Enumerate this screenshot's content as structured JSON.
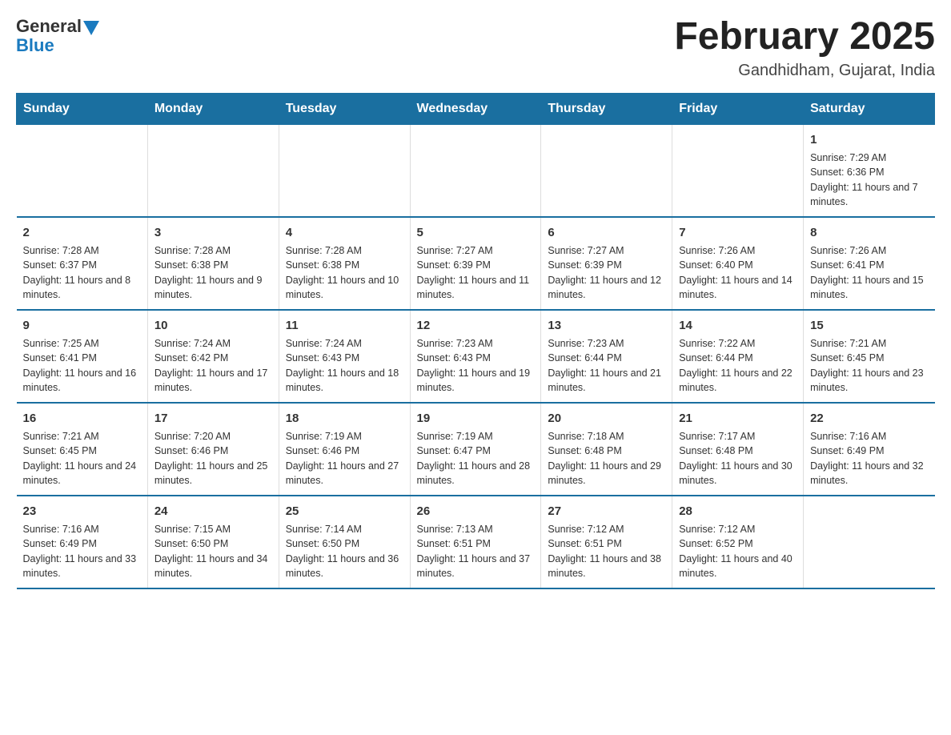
{
  "logo": {
    "general": "General",
    "blue": "Blue"
  },
  "title": "February 2025",
  "subtitle": "Gandhidham, Gujarat, India",
  "weekdays": [
    "Sunday",
    "Monday",
    "Tuesday",
    "Wednesday",
    "Thursday",
    "Friday",
    "Saturday"
  ],
  "weeks": [
    [
      {
        "day": "",
        "info": ""
      },
      {
        "day": "",
        "info": ""
      },
      {
        "day": "",
        "info": ""
      },
      {
        "day": "",
        "info": ""
      },
      {
        "day": "",
        "info": ""
      },
      {
        "day": "",
        "info": ""
      },
      {
        "day": "1",
        "info": "Sunrise: 7:29 AM\nSunset: 6:36 PM\nDaylight: 11 hours and 7 minutes."
      }
    ],
    [
      {
        "day": "2",
        "info": "Sunrise: 7:28 AM\nSunset: 6:37 PM\nDaylight: 11 hours and 8 minutes."
      },
      {
        "day": "3",
        "info": "Sunrise: 7:28 AM\nSunset: 6:38 PM\nDaylight: 11 hours and 9 minutes."
      },
      {
        "day": "4",
        "info": "Sunrise: 7:28 AM\nSunset: 6:38 PM\nDaylight: 11 hours and 10 minutes."
      },
      {
        "day": "5",
        "info": "Sunrise: 7:27 AM\nSunset: 6:39 PM\nDaylight: 11 hours and 11 minutes."
      },
      {
        "day": "6",
        "info": "Sunrise: 7:27 AM\nSunset: 6:39 PM\nDaylight: 11 hours and 12 minutes."
      },
      {
        "day": "7",
        "info": "Sunrise: 7:26 AM\nSunset: 6:40 PM\nDaylight: 11 hours and 14 minutes."
      },
      {
        "day": "8",
        "info": "Sunrise: 7:26 AM\nSunset: 6:41 PM\nDaylight: 11 hours and 15 minutes."
      }
    ],
    [
      {
        "day": "9",
        "info": "Sunrise: 7:25 AM\nSunset: 6:41 PM\nDaylight: 11 hours and 16 minutes."
      },
      {
        "day": "10",
        "info": "Sunrise: 7:24 AM\nSunset: 6:42 PM\nDaylight: 11 hours and 17 minutes."
      },
      {
        "day": "11",
        "info": "Sunrise: 7:24 AM\nSunset: 6:43 PM\nDaylight: 11 hours and 18 minutes."
      },
      {
        "day": "12",
        "info": "Sunrise: 7:23 AM\nSunset: 6:43 PM\nDaylight: 11 hours and 19 minutes."
      },
      {
        "day": "13",
        "info": "Sunrise: 7:23 AM\nSunset: 6:44 PM\nDaylight: 11 hours and 21 minutes."
      },
      {
        "day": "14",
        "info": "Sunrise: 7:22 AM\nSunset: 6:44 PM\nDaylight: 11 hours and 22 minutes."
      },
      {
        "day": "15",
        "info": "Sunrise: 7:21 AM\nSunset: 6:45 PM\nDaylight: 11 hours and 23 minutes."
      }
    ],
    [
      {
        "day": "16",
        "info": "Sunrise: 7:21 AM\nSunset: 6:45 PM\nDaylight: 11 hours and 24 minutes."
      },
      {
        "day": "17",
        "info": "Sunrise: 7:20 AM\nSunset: 6:46 PM\nDaylight: 11 hours and 25 minutes."
      },
      {
        "day": "18",
        "info": "Sunrise: 7:19 AM\nSunset: 6:46 PM\nDaylight: 11 hours and 27 minutes."
      },
      {
        "day": "19",
        "info": "Sunrise: 7:19 AM\nSunset: 6:47 PM\nDaylight: 11 hours and 28 minutes."
      },
      {
        "day": "20",
        "info": "Sunrise: 7:18 AM\nSunset: 6:48 PM\nDaylight: 11 hours and 29 minutes."
      },
      {
        "day": "21",
        "info": "Sunrise: 7:17 AM\nSunset: 6:48 PM\nDaylight: 11 hours and 30 minutes."
      },
      {
        "day": "22",
        "info": "Sunrise: 7:16 AM\nSunset: 6:49 PM\nDaylight: 11 hours and 32 minutes."
      }
    ],
    [
      {
        "day": "23",
        "info": "Sunrise: 7:16 AM\nSunset: 6:49 PM\nDaylight: 11 hours and 33 minutes."
      },
      {
        "day": "24",
        "info": "Sunrise: 7:15 AM\nSunset: 6:50 PM\nDaylight: 11 hours and 34 minutes."
      },
      {
        "day": "25",
        "info": "Sunrise: 7:14 AM\nSunset: 6:50 PM\nDaylight: 11 hours and 36 minutes."
      },
      {
        "day": "26",
        "info": "Sunrise: 7:13 AM\nSunset: 6:51 PM\nDaylight: 11 hours and 37 minutes."
      },
      {
        "day": "27",
        "info": "Sunrise: 7:12 AM\nSunset: 6:51 PM\nDaylight: 11 hours and 38 minutes."
      },
      {
        "day": "28",
        "info": "Sunrise: 7:12 AM\nSunset: 6:52 PM\nDaylight: 11 hours and 40 minutes."
      },
      {
        "day": "",
        "info": ""
      }
    ]
  ]
}
